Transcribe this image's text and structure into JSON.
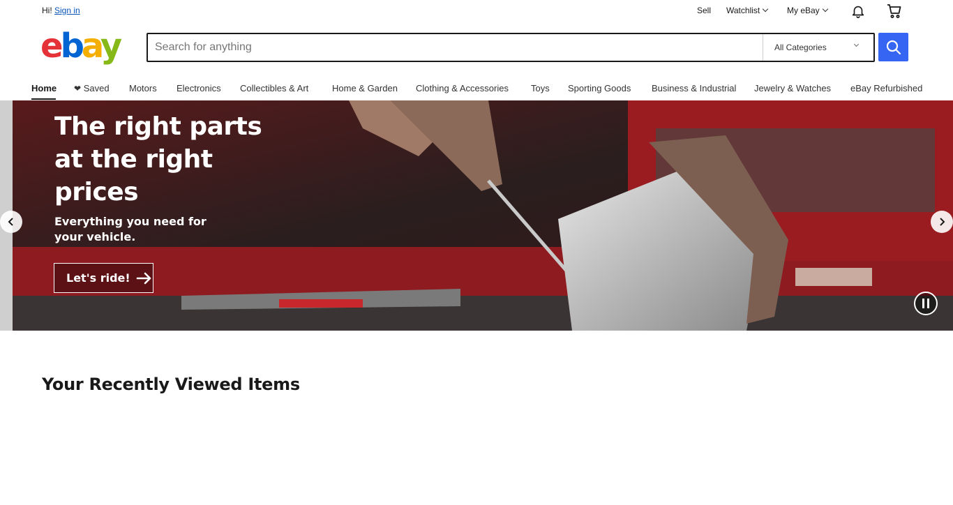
{
  "topbar": {
    "greeting": "Hi!",
    "sign_in": "Sign in",
    "sell": "Sell",
    "watchlist": "Watchlist",
    "my_ebay": "My eBay"
  },
  "header": {
    "logo_letters": [
      "e",
      "b",
      "a",
      "y"
    ],
    "logo_colors": [
      "#e53238",
      "#0064d2",
      "#f5af02",
      "#86b817"
    ],
    "search_placeholder": "Search for anything",
    "category_selected": "All Categories"
  },
  "nav": {
    "items": [
      {
        "label": "Home"
      },
      {
        "label": "Saved"
      },
      {
        "label": "Motors"
      },
      {
        "label": "Electronics"
      },
      {
        "label": "Collectibles & Art"
      },
      {
        "label": "Home & Garden"
      },
      {
        "label": "Clothing & Accessories"
      },
      {
        "label": "Toys"
      },
      {
        "label": "Sporting Goods"
      },
      {
        "label": "Business & Industrial"
      },
      {
        "label": "Jewelry & Watches"
      },
      {
        "label": "eBay Refurbished"
      }
    ]
  },
  "hero": {
    "title": "The right parts at the right prices",
    "subtitle": "Everything you need for your vehicle.",
    "cta": "Let's ride!"
  },
  "recent": {
    "title": "Your Recently Viewed Items"
  },
  "colors": {
    "accent": "#3665f3",
    "link": "#0654ba"
  }
}
